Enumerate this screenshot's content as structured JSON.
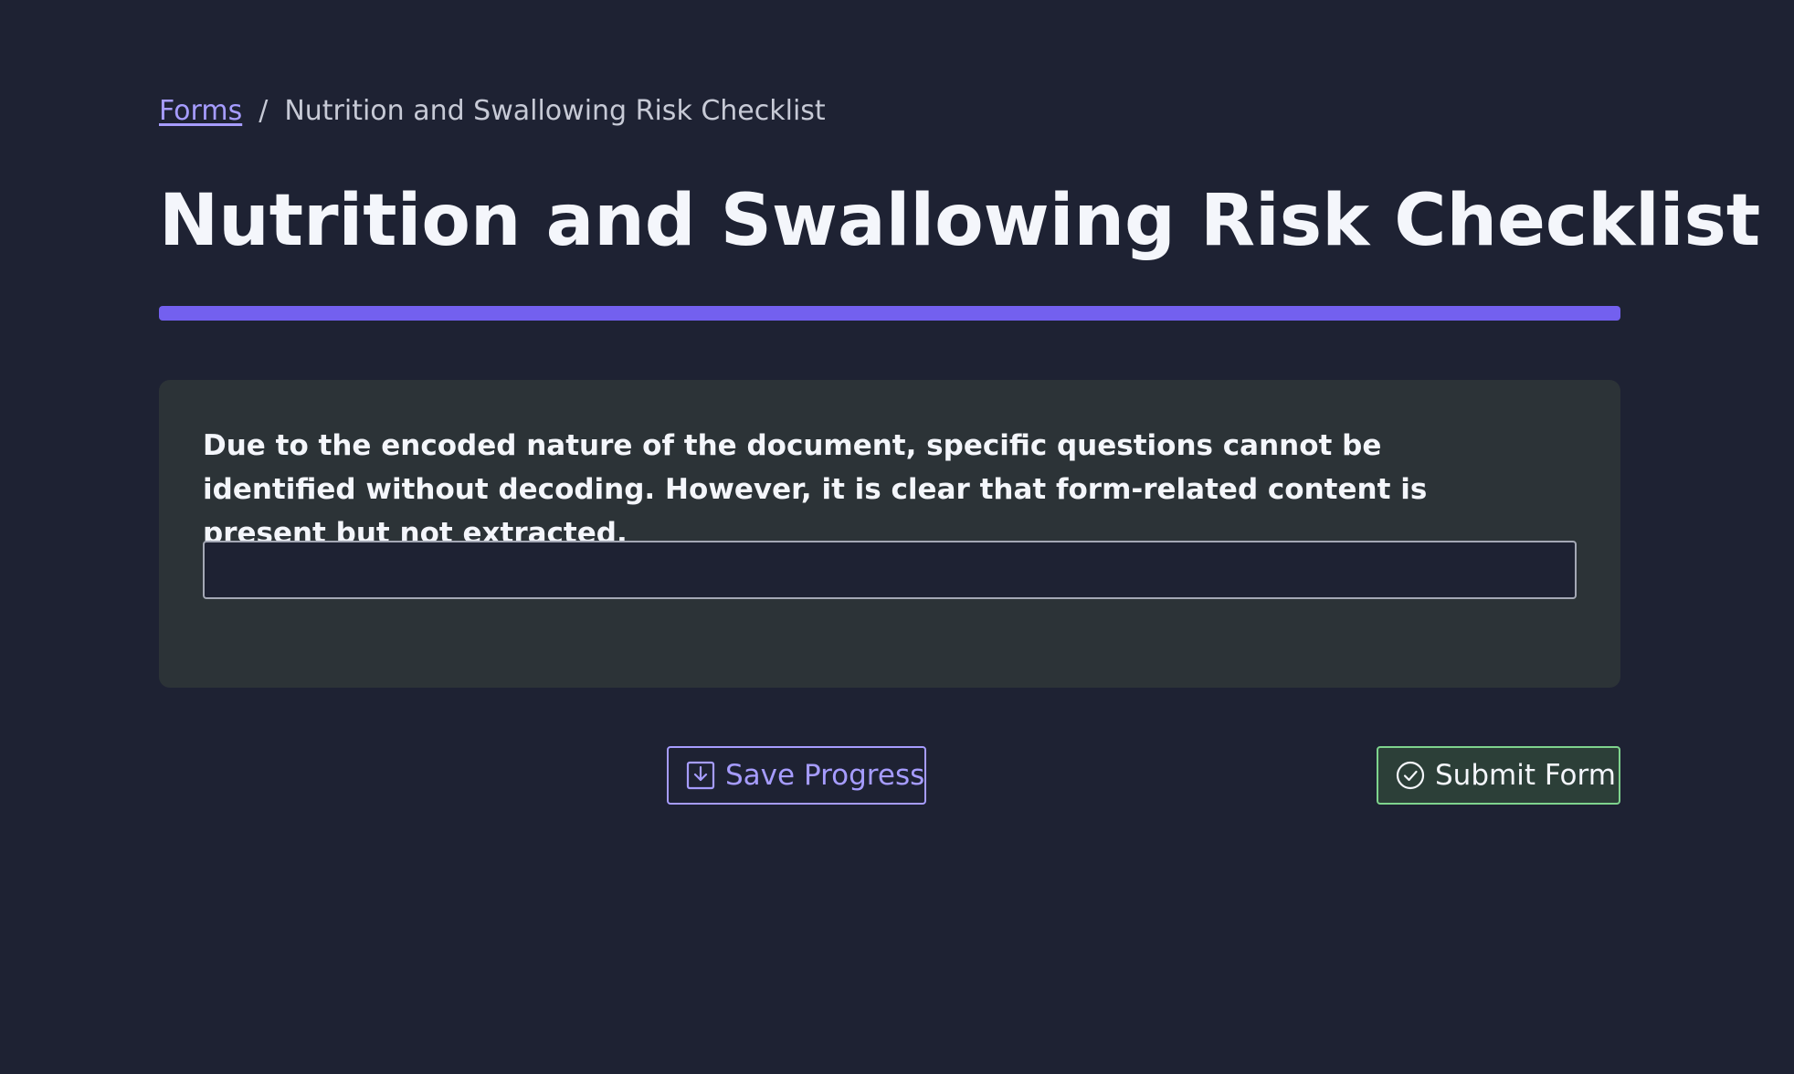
{
  "breadcrumb": {
    "link_label": "Forms",
    "separator": "/",
    "current": "Nutrition and Swallowing Risk Checklist"
  },
  "page_title": "Nutrition and Swallowing Risk Checklist",
  "question": {
    "text": "Due to the encoded nature of the document, specific questions cannot be identified without decoding. However, it is clear that form-related content is present but not extracted.",
    "answer_value": "",
    "answer_placeholder": ""
  },
  "actions": {
    "save_label": "Save Progress",
    "save_icon": "save-download-icon",
    "submit_label": "Submit Form",
    "submit_icon": "check-circle-icon"
  },
  "colors": {
    "background": "#1e2233",
    "accent": "#7360ef",
    "link": "#a69cff",
    "card": "#2c3337",
    "submit_border": "#7ed38d"
  }
}
